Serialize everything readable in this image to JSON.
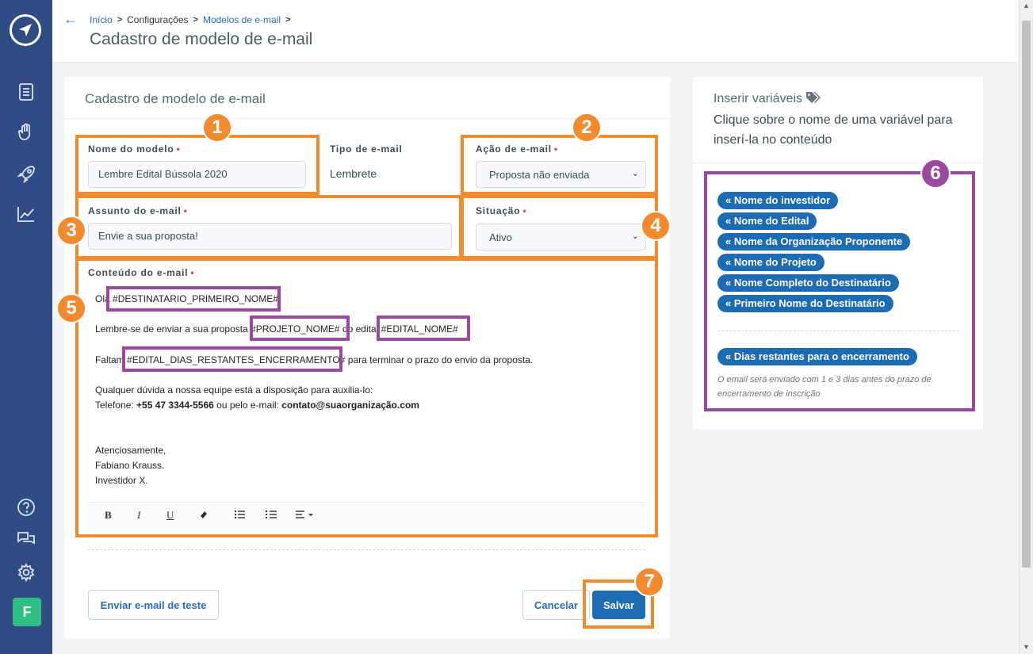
{
  "breadcrumb": {
    "items": [
      "Início",
      "Configurações",
      "Modelos de e-mail"
    ]
  },
  "header": {
    "title": "Cadastro de modelo de e-mail"
  },
  "form": {
    "card_title": "Cadastro de modelo de e-mail",
    "nome_label": "Nome do modelo",
    "nome_value": "Lembre Edital Bússola 2020",
    "tipo_label": "Tipo de e-mail",
    "tipo_value": "Lembrete",
    "acao_label": "Ação de e-mail",
    "acao_value": "Proposta não enviada",
    "assunto_label": "Assunto do e-mail",
    "assunto_value": "Envie a sua proposta!",
    "situacao_label": "Situação",
    "situacao_value": "Ativo",
    "conteudo_label": "Conteúdo do e-mail",
    "required_mark": "•"
  },
  "editor": {
    "line1_pre": "Olá ",
    "line1_var": "#DESTINATARIO_PRIMEIRO_NOME#",
    "line2_pre": "Lembre-se de enviar a sua proposta ",
    "line2_var1": "#PROJETO_NOME#",
    "line2_mid": " do edital ",
    "line2_var2": "#EDITAL_NOME#",
    "line3_pre": "Faltam ",
    "line3_var": "#EDITAL_DIAS_RESTANTES_ENCERRAMENTO#",
    "line3_post": " para terminar o prazo do envio da proposta.",
    "line4": "Qualquer dúvida a nossa equipe está a disposição para auxilia-lo:",
    "line5_pre": "Telefone: ",
    "line5_phone": "+55 47 3344-5566",
    "line5_mid": " ou pelo e-mail: ",
    "line5_email": "contato@suaorganização.com",
    "line6": "Atenciosamente,",
    "line7": "Fabiano Krauss.",
    "line8": "Investidor X."
  },
  "toolbar": {
    "bold": "B",
    "italic": "I",
    "underline": "U"
  },
  "buttons": {
    "test": "Enviar e-mail de teste",
    "cancel": "Cancelar",
    "save": "Salvar"
  },
  "variables": {
    "title": "Inserir variáveis",
    "subtitle": "Clique sobre o nome de uma variável para inserí-la no conteúdo",
    "chips": [
      "Nome do investidor",
      "Nome do Edital",
      "Nome da Organização Proponente",
      "Nome do Projeto",
      "Nome Completo do Destinatário",
      "Primeiro Nome do Destinatário"
    ],
    "extra_chip": "Dias restantes para o encerramento",
    "note": "O email será enviado com 1 e 3 dias antes do prazo de encerramento de inscrição",
    "chip_prefix": "«"
  },
  "user": {
    "avatar_letter": "F"
  },
  "callouts": [
    "1",
    "2",
    "3",
    "4",
    "5",
    "6",
    "7"
  ],
  "colors": {
    "accent": "#1d6bb3",
    "sidebar": "#2f4d84",
    "highlight_orange": "#f28b2e",
    "highlight_purple": "#9a4a9e"
  }
}
